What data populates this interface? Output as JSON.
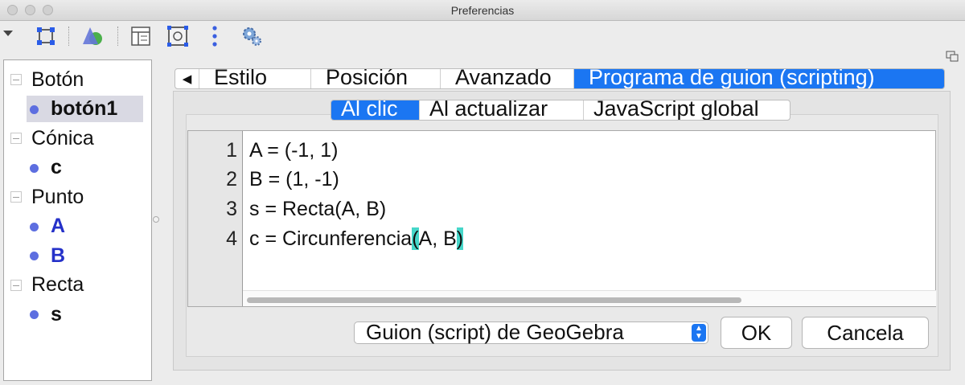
{
  "window": {
    "title": "Preferencias"
  },
  "toolbar": {
    "icons": [
      "menu-triangle-icon",
      "select-object-icon",
      "graphics-view-icon",
      "layout-icon",
      "snapshot-icon",
      "dots-menu-icon",
      "settings-gear-icon"
    ]
  },
  "tree": {
    "groups": [
      {
        "category": "Botón",
        "objects": [
          {
            "name": "botón1",
            "color": "#111111",
            "selected": true
          }
        ]
      },
      {
        "category": "Cónica",
        "objects": [
          {
            "name": "c",
            "color": "#111111"
          }
        ]
      },
      {
        "category": "Punto",
        "objects": [
          {
            "name": "A",
            "color": "#2531c9"
          },
          {
            "name": "B",
            "color": "#2531c9"
          }
        ]
      },
      {
        "category": "Recta",
        "objects": [
          {
            "name": "s",
            "color": "#111111"
          }
        ]
      }
    ]
  },
  "tabs": [
    {
      "label": "Estilo",
      "active": false
    },
    {
      "label": "Posición",
      "active": false
    },
    {
      "label": "Avanzado",
      "active": false
    },
    {
      "label": "Programa de guion (scripting)",
      "active": true
    }
  ],
  "subtabs": [
    {
      "label": "Al clic",
      "active": true
    },
    {
      "label": "Al actualizar",
      "active": false
    },
    {
      "label": "JavaScript global",
      "active": false
    }
  ],
  "editor": {
    "lines": [
      {
        "number": "1",
        "text": "A = (-1, 1)"
      },
      {
        "number": "2",
        "text": "B = (1, -1)"
      },
      {
        "number": "3",
        "text": "s = Recta(A, B)"
      },
      {
        "number": "4",
        "text_before": "c = Circunferencia",
        "bracket_open": "(",
        "text_middle": "A, B",
        "bracket_close": ")"
      }
    ],
    "bracket_highlight_color": "#46d6c9"
  },
  "footer": {
    "script_type": "Guion (script) de GeoGebra",
    "ok_label": "OK",
    "cancel_label": "Cancela"
  },
  "colors": {
    "accent": "#1b76f2",
    "point_bullet": "#5d6ee0"
  }
}
